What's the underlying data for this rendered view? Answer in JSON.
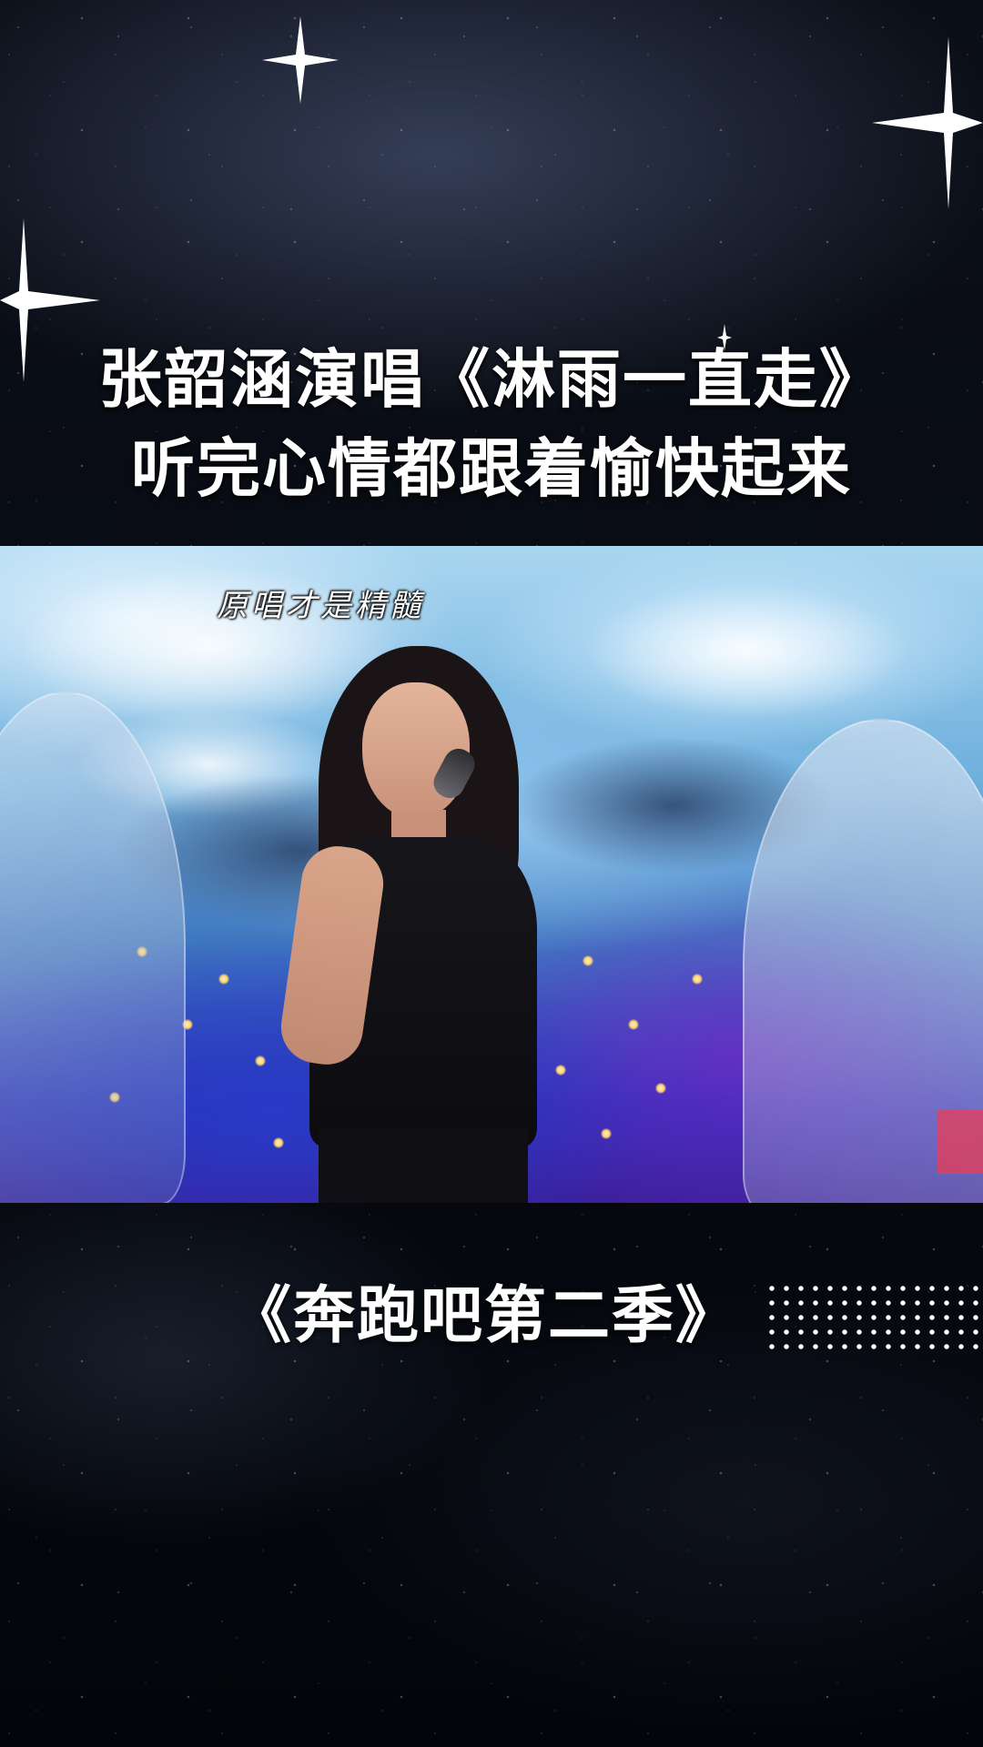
{
  "headline": {
    "line1": "张韶涵演唱《淋雨一直走》",
    "line2": "听完心情都跟着愉快起来"
  },
  "video": {
    "caption": "原唱才是精髓"
  },
  "show_title": "《奔跑吧第二季》",
  "decorations": {
    "sparkle_icon": "four-point-star-icon",
    "dot_pattern": "dot-grid",
    "background": "starry-night-sky"
  },
  "colors": {
    "text": "#ffffff",
    "background": "#05070d",
    "sky_blue": "#6fb0dd",
    "stage_purple": "#3b1f9a"
  }
}
